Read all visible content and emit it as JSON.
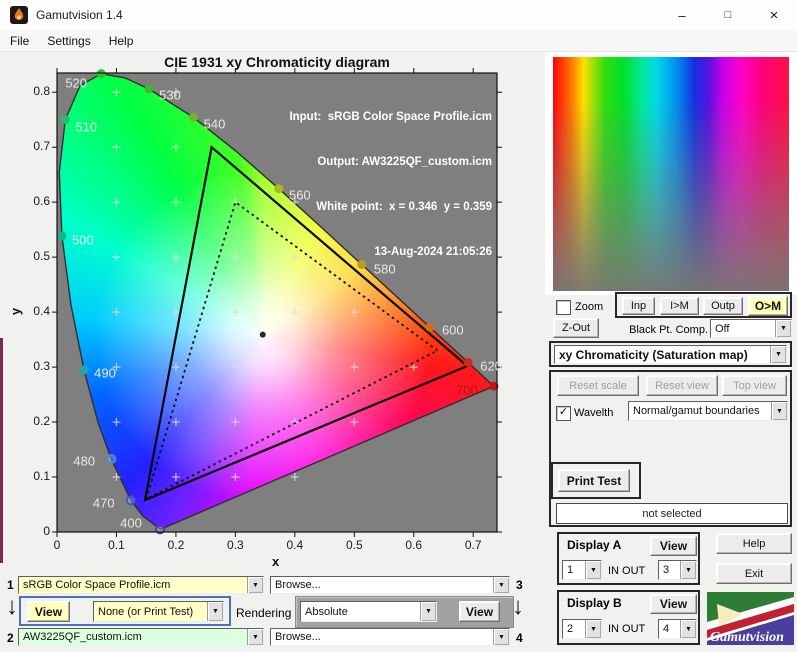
{
  "window": {
    "title": "Gamutvision 1.4"
  },
  "icons": {
    "combo_arrow": "▼",
    "down_arrow": "↓",
    "check": "✓",
    "minimize": "–",
    "maximize": "□",
    "close": "×"
  },
  "menu": {
    "items": [
      "File",
      "Settings",
      "Help"
    ]
  },
  "figure": {
    "title": "CIE 1931 xy Chromaticity diagram",
    "xlabel": "x",
    "ylabel": "y",
    "annotation": [
      "Input:  sRGB Color Space Profile.icm",
      "Output: AW3225QF_custom.icm",
      "White point:  x = 0.346  y = 0.359",
      "13-Aug-2024 21:05:26"
    ]
  },
  "chart_data": {
    "type": "chromaticity_diagram",
    "title": "CIE 1931 xy Chromaticity diagram",
    "xlabel": "x",
    "ylabel": "y",
    "xlim": [
      0,
      0.74
    ],
    "ylim": [
      0,
      0.835
    ],
    "x_ticks": [
      0,
      0.1,
      0.2,
      0.3,
      0.4,
      0.5,
      0.6,
      0.7
    ],
    "x_tick_labels": [
      "0",
      "0.1",
      "0.2",
      "0.3",
      "0.4",
      "0.5",
      "0.6",
      "0.7"
    ],
    "y_ticks": [
      0,
      0.1,
      0.2,
      0.3,
      0.4,
      0.5,
      0.6,
      0.7,
      0.8
    ],
    "y_tick_labels": [
      "0",
      "0.1",
      "0.2",
      "0.3",
      "0.4",
      "0.5",
      "0.6",
      "0.7",
      "0.8"
    ],
    "white_point": {
      "x": 0.346,
      "y": 0.359
    },
    "spectral_locus": [
      [
        0.1741,
        0.005
      ],
      [
        0.144,
        0.0297
      ],
      [
        0.1241,
        0.0578
      ],
      [
        0.0913,
        0.1327
      ],
      [
        0.0687,
        0.2007
      ],
      [
        0.0454,
        0.295
      ],
      [
        0.0235,
        0.4127
      ],
      [
        0.0082,
        0.5384
      ],
      [
        0.0039,
        0.6548
      ],
      [
        0.0139,
        0.7502
      ],
      [
        0.0389,
        0.812
      ],
      [
        0.0743,
        0.8338
      ],
      [
        0.1142,
        0.8262
      ],
      [
        0.1547,
        0.8059
      ],
      [
        0.2296,
        0.7543
      ],
      [
        0.3016,
        0.6923
      ],
      [
        0.3731,
        0.6245
      ],
      [
        0.4441,
        0.5547
      ],
      [
        0.5125,
        0.4866
      ],
      [
        0.5752,
        0.4242
      ],
      [
        0.627,
        0.3725
      ],
      [
        0.6658,
        0.334
      ],
      [
        0.6915,
        0.3083
      ],
      [
        0.7079,
        0.292
      ],
      [
        0.719,
        0.2809
      ],
      [
        0.7347,
        0.2653
      ]
    ],
    "locus_markers": [
      {
        "label": "520",
        "x": 0.0743,
        "y": 0.8338,
        "color": "#2ebf3a",
        "ox": -25,
        "oy": 9
      },
      {
        "label": "530",
        "x": 0.1547,
        "y": 0.8059,
        "color": "#3bb92e",
        "ox": 21,
        "oy": 6
      },
      {
        "label": "540",
        "x": 0.2296,
        "y": 0.7543,
        "color": "#7ab02a",
        "ox": 21,
        "oy": 7
      },
      {
        "label": "510",
        "x": 0.0139,
        "y": 0.7502,
        "color": "#2db96a",
        "ox": 21,
        "oy": 7
      },
      {
        "label": "560",
        "x": 0.3731,
        "y": 0.6245,
        "color": "#a8b81f",
        "ox": 21,
        "oy": 6
      },
      {
        "label": "500",
        "x": 0.0082,
        "y": 0.5384,
        "color": "#18b287",
        "ox": 21,
        "oy": 4
      },
      {
        "label": "580",
        "x": 0.5125,
        "y": 0.4866,
        "color": "#b89b1c",
        "ox": 23,
        "oy": 4
      },
      {
        "label": "600",
        "x": 0.627,
        "y": 0.3725,
        "color": "#c9701a",
        "ox": 23,
        "oy": 3
      },
      {
        "label": "620",
        "x": 0.6915,
        "y": 0.3083,
        "color": "#cc2a1e",
        "ox": 23,
        "oy": 3
      },
      {
        "label": "700",
        "x": 0.7347,
        "y": 0.2653,
        "color": "#c11616",
        "ox": -27,
        "oy": 4,
        "label_color": "#b01212"
      },
      {
        "label": "490",
        "x": 0.0454,
        "y": 0.295,
        "color": "#23a8a8",
        "ox": 21,
        "oy": 3
      },
      {
        "label": "480",
        "x": 0.0913,
        "y": 0.1327,
        "color": "#4f87c9",
        "ox": -27,
        "oy": 2,
        "hollow": true
      },
      {
        "label": "470",
        "x": 0.1241,
        "y": 0.0578,
        "color": "#3c55c8",
        "ox": -27,
        "oy": 3,
        "hollow": true
      },
      {
        "label": "400",
        "x": 0.1733,
        "y": 0.0048,
        "color": "#4b3fb0",
        "ox": -29,
        "oy": -6,
        "hollow": true
      }
    ],
    "gamuts": [
      {
        "name": "input sRGB Color Space Profile.icm",
        "style": "dotted",
        "vertices": [
          [
            0.64,
            0.33
          ],
          [
            0.3,
            0.6
          ],
          [
            0.15,
            0.06
          ]
        ]
      },
      {
        "name": "output AW3225QF_custom.icm",
        "style": "solid",
        "vertices": [
          [
            0.69,
            0.302
          ],
          [
            0.26,
            0.7
          ],
          [
            0.148,
            0.058
          ]
        ]
      }
    ],
    "grid_marks": [
      [
        0.1,
        0.8
      ],
      [
        0.2,
        0.8
      ],
      [
        0.1,
        0.7
      ],
      [
        0.2,
        0.7
      ],
      [
        0.1,
        0.6
      ],
      [
        0.2,
        0.6
      ],
      [
        0.3,
        0.6
      ],
      [
        0.4,
        0.6
      ],
      [
        0.1,
        0.5
      ],
      [
        0.2,
        0.5
      ],
      [
        0.3,
        0.5
      ],
      [
        0.4,
        0.5
      ],
      [
        0.1,
        0.4
      ],
      [
        0.2,
        0.4
      ],
      [
        0.3,
        0.4
      ],
      [
        0.4,
        0.4
      ],
      [
        0.5,
        0.4
      ],
      [
        0.1,
        0.3
      ],
      [
        0.2,
        0.3
      ],
      [
        0.3,
        0.3
      ],
      [
        0.4,
        0.3
      ],
      [
        0.5,
        0.3
      ],
      [
        0.6,
        0.3
      ],
      [
        0.1,
        0.2
      ],
      [
        0.2,
        0.2
      ],
      [
        0.3,
        0.2
      ],
      [
        0.4,
        0.2
      ],
      [
        0.5,
        0.2
      ],
      [
        0.1,
        0.1
      ],
      [
        0.2,
        0.1
      ],
      [
        0.3,
        0.1
      ],
      [
        0.4,
        0.1
      ]
    ]
  },
  "right_panel": {
    "zoom_label": "Zoom",
    "zout": "Z-Out",
    "buttons": {
      "inp": "Inp",
      "im": "I>M",
      "outp": "Outp",
      "om": "O>M"
    },
    "bpc_label": "Black Pt. Comp.",
    "bpc_value": "Off",
    "view_mode": "xy Chromaticity (Saturation map)",
    "reset_scale": "Reset scale",
    "reset_view": "Reset view",
    "top_view": "Top view",
    "wavelth_label": "Wavelth",
    "boundaries_value": "Normal/gamut boundaries",
    "print_test": "Print Test",
    "status": "not selected",
    "display_a": {
      "label": "Display A",
      "view": "View",
      "in_value": "1",
      "inout": "IN  OUT",
      "out_value": "3"
    },
    "display_b": {
      "label": "Display B",
      "view": "View",
      "in_value": "2",
      "inout": "IN  OUT",
      "out_value": "4"
    },
    "help": "Help",
    "exit": "Exit",
    "logo_text": "Gamutvision"
  },
  "bottom_panel": {
    "row1": {
      "num": "1",
      "profile": "sRGB Color Space Profile.icm",
      "browse": "Browse...",
      "num_right": "3"
    },
    "mid": {
      "view_a": "View",
      "test_pattern": "None (or Print Test)",
      "rendering_label": "Rendering",
      "intent": "Absolute",
      "view_b": "View"
    },
    "row2": {
      "num": "2",
      "profile": "AW3225QF_custom.icm",
      "browse": "Browse...",
      "num_right": "4"
    }
  },
  "colors": {
    "highlight_yellow": "#ffffb8",
    "input_field_yellow": "#ffffc8",
    "output_field_green": "#ddffdd",
    "selection_blue": "#4a74ba",
    "plot_background": "#7f7f7f"
  }
}
